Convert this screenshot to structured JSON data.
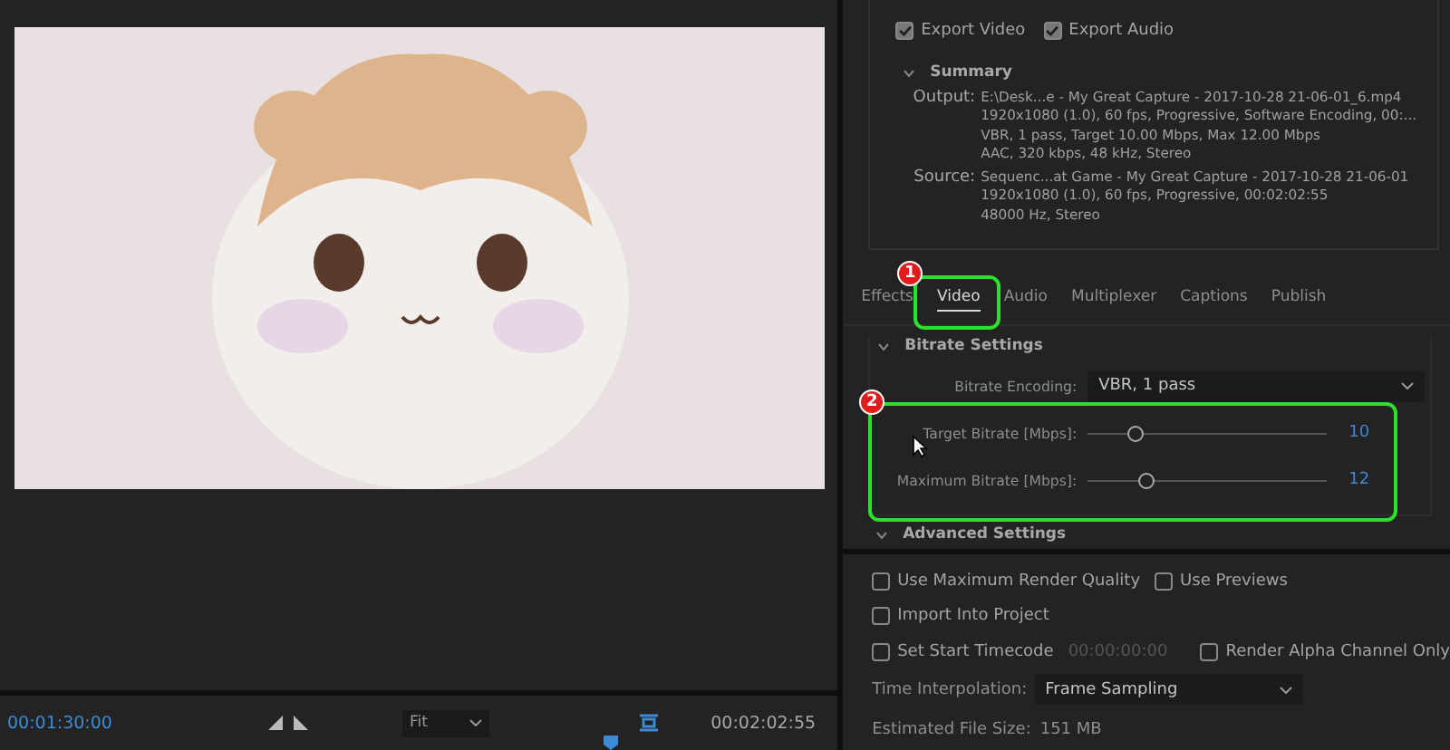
{
  "preview": {
    "start_time": "00:01:30:00",
    "zoom": "Fit",
    "end_time": "00:02:02:55"
  },
  "export": [
    {
      "label": "Export Video",
      "checked": true
    },
    {
      "label": "Export Audio",
      "checked": true
    }
  ],
  "summary": {
    "title": "Summary",
    "expanded": true,
    "entries": [
      {
        "label": "Output:",
        "lines": [
          "E:\\Desk...e - My Great Capture - 2017-10-28 21-06-01_6.mp4",
          "1920x1080 (1.0), 60 fps, Progressive, Software Encoding, 00:...",
          "VBR, 1 pass, Target 10.00 Mbps, Max 12.00 Mbps",
          "AAC, 320 kbps, 48 kHz, Stereo"
        ]
      },
      {
        "label": "Source:",
        "lines": [
          "Sequenc...at Game - My Great Capture - 2017-10-28 21-06-01",
          "1920x1080 (1.0), 60 fps, Progressive, 00:02:02:55",
          "48000 Hz, Stereo"
        ]
      }
    ]
  },
  "tabs": [
    {
      "label": "Effects",
      "selected": false
    },
    {
      "label": "Video",
      "selected": true
    },
    {
      "label": "Audio",
      "selected": false
    },
    {
      "label": "Multiplexer",
      "selected": false
    },
    {
      "label": "Captions",
      "selected": false
    },
    {
      "label": "Publish",
      "selected": false
    }
  ],
  "bitrate": {
    "title": "Bitrate Settings",
    "expanded": true,
    "encoding_label": "Bitrate Encoding:",
    "encoding_value": "VBR, 1 pass",
    "sliders": [
      {
        "label": "Target Bitrate [Mbps]:",
        "level": 0.2,
        "value": "10"
      },
      {
        "label": "Maximum Bitrate [Mbps]:",
        "level": 0.24,
        "value": "12"
      }
    ]
  },
  "advanced": {
    "title": "Advanced Settings"
  },
  "option_rows": [
    [
      {
        "label": "Use Maximum Render Quality",
        "checked": false
      },
      {
        "label": "Use Previews",
        "checked": false
      }
    ],
    [
      {
        "label": "Import Into Project",
        "checked": false
      }
    ],
    [
      {
        "label": "Set Start Timecode",
        "checked": false,
        "timecode": "00:00:00:00"
      },
      {
        "label": "Render Alpha Channel Only",
        "checked": false
      }
    ]
  ],
  "time_interpolation": {
    "label": "Time Interpolation:",
    "value": "Frame Sampling"
  },
  "file_size": {
    "label": "Estimated File Size:",
    "value": "151 MB"
  },
  "annotations": [
    {
      "number": "1"
    },
    {
      "number": "2"
    }
  ]
}
